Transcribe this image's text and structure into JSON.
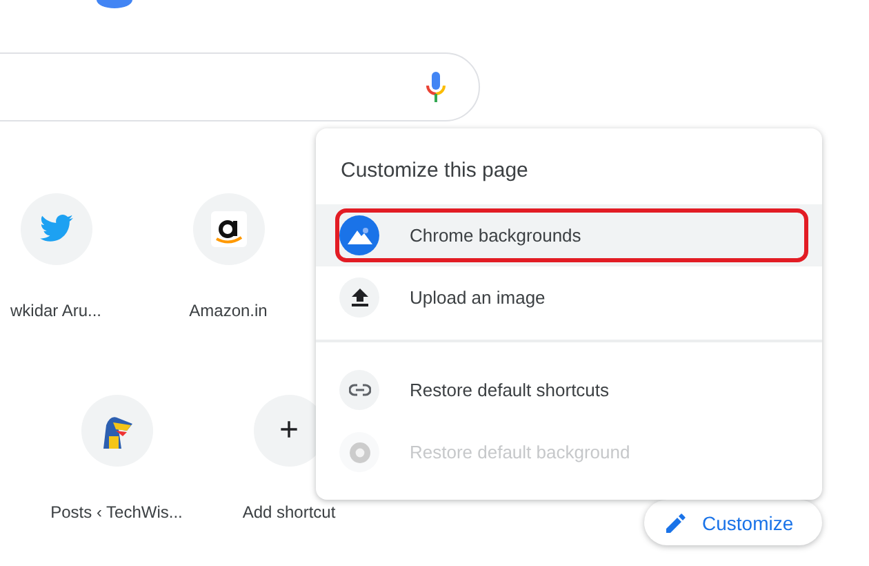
{
  "shortcuts": [
    [
      {
        "label": "wkidar Aru..."
      },
      {
        "label": "Amazon.in"
      }
    ],
    [
      {
        "label": "Posts ‹ TechWis..."
      },
      {
        "label": "Add shortcut"
      }
    ]
  ],
  "add_glyph": "+",
  "menu": {
    "title": "Customize this page",
    "sections": [
      [
        {
          "label": "Chrome backgrounds",
          "highlighted": true,
          "disabled": false
        },
        {
          "label": "Upload an image",
          "highlighted": false,
          "disabled": false
        }
      ],
      [
        {
          "label": "Restore default shortcuts",
          "highlighted": false,
          "disabled": false
        },
        {
          "label": "Restore default background",
          "highlighted": false,
          "disabled": true
        }
      ]
    ]
  },
  "customize_button": {
    "label": "Customize"
  }
}
